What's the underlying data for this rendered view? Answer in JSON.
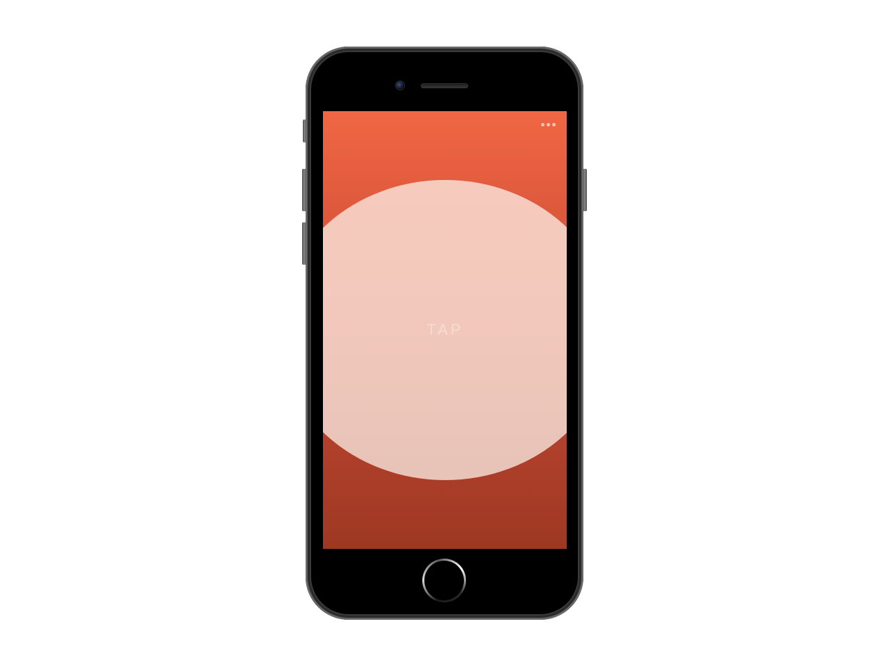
{
  "device": {
    "model_icon": "smartphone-icon",
    "body_color": "#000000",
    "frame_color": "#6a6a6a"
  },
  "screen": {
    "background_top": "#ef6744",
    "background_bottom": "#9e3822",
    "menu": {
      "icon": "more-horizontal-icon",
      "dot_color": "#f6c8b7"
    },
    "tap_circle": {
      "label": "TAP",
      "fill_top": "#f6cbbd",
      "fill_bottom": "#e7c3b8"
    }
  },
  "hardware": {
    "home_button_icon": "home-button-icon"
  }
}
